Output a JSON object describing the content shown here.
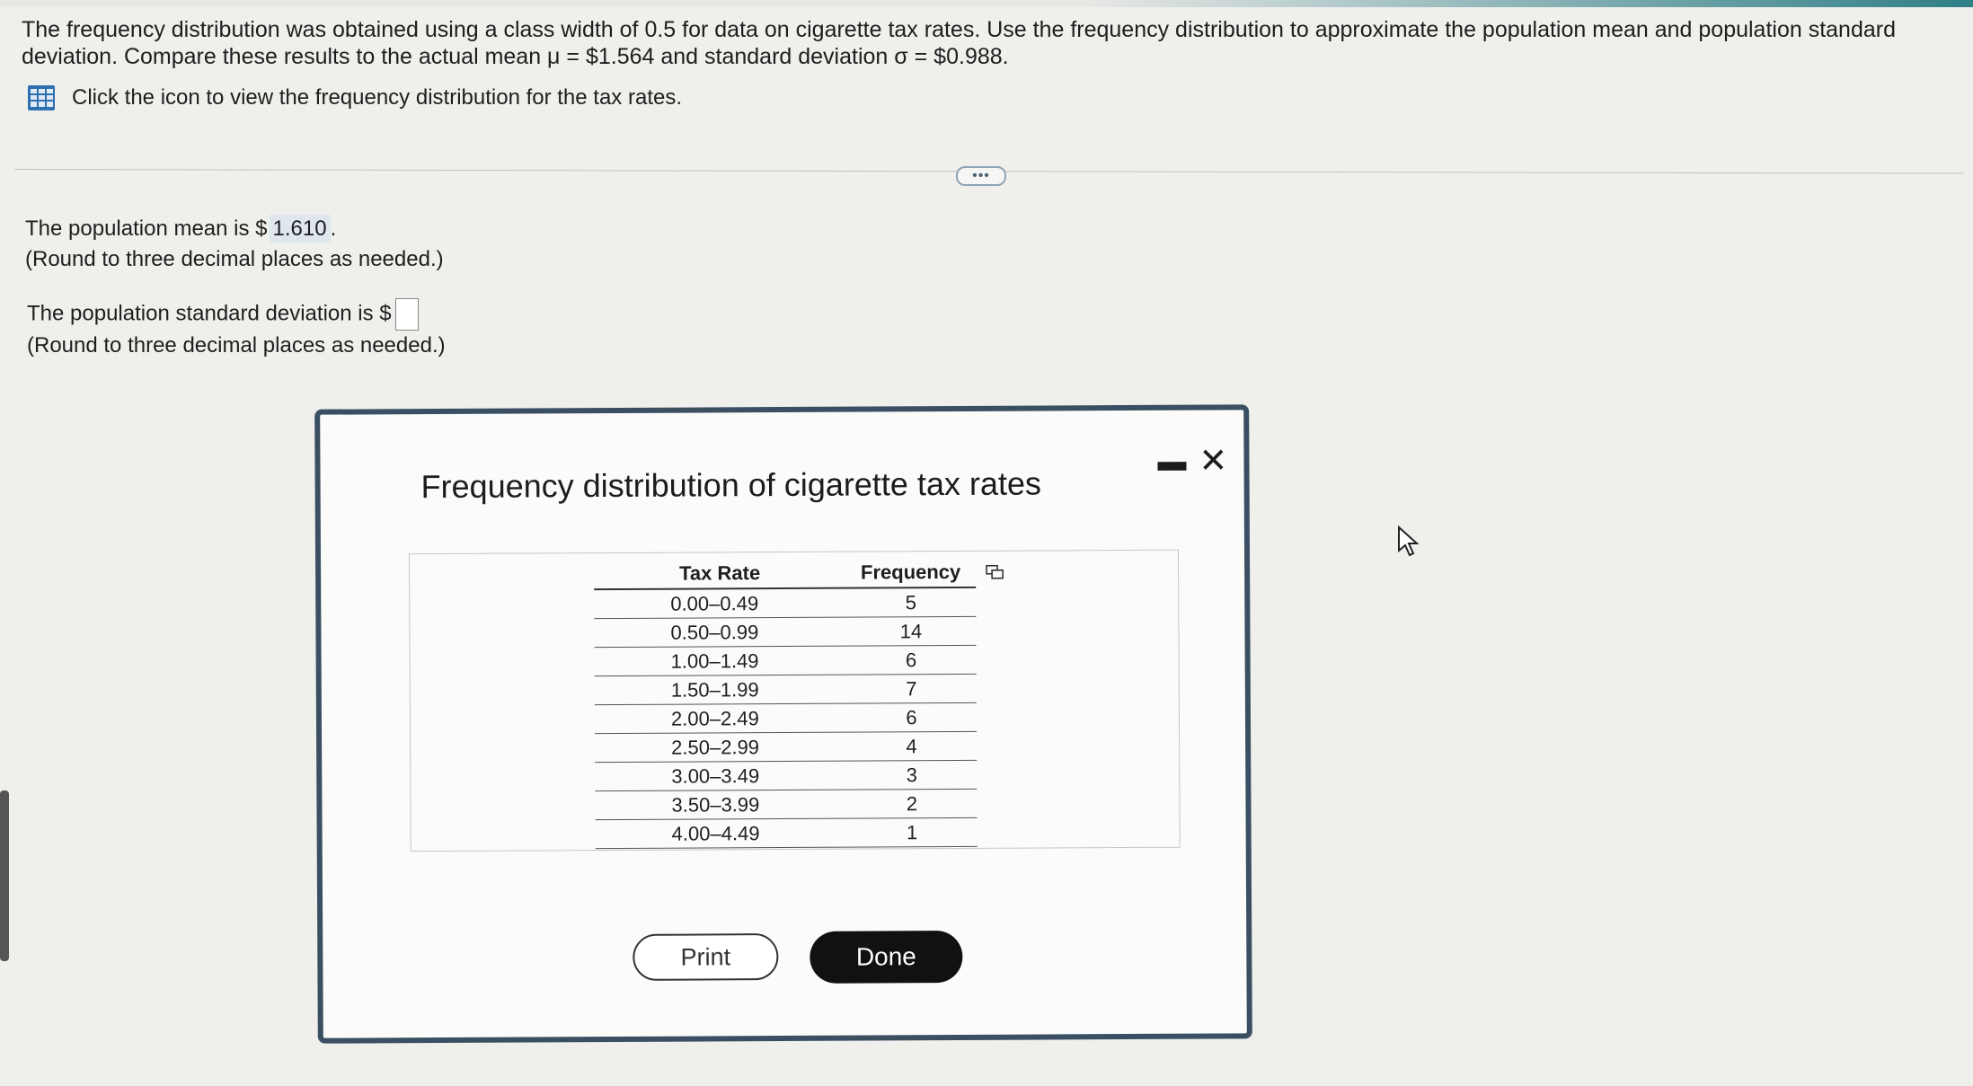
{
  "question": {
    "line1": "The frequency distribution was obtained using a class width of 0.5 for data on cigarette tax rates. Use the frequency distribution to approximate the population mean and population standard deviation. Compare these results to the actual mean μ = $1.564 and standard deviation σ = $0.988.",
    "hint": "Click the icon to view the frequency distribution for the tax rates."
  },
  "more_label": "•••",
  "answers": {
    "mean_prefix": "The population mean is $",
    "mean_value": "1.610",
    "mean_suffix": ".",
    "mean_note": "(Round to three decimal places as needed.)",
    "sd_prefix": "The population standard deviation is $",
    "sd_note": "(Round to three decimal places as needed.)"
  },
  "dialog": {
    "title": "Frequency distribution of cigarette tax rates",
    "minimize_icon": "minimize-icon",
    "close_icon": "close-icon",
    "table": {
      "headers": [
        "Tax Rate",
        "Frequency"
      ],
      "rows": [
        [
          "0.00–0.49",
          "5"
        ],
        [
          "0.50–0.99",
          "14"
        ],
        [
          "1.00–1.49",
          "6"
        ],
        [
          "1.50–1.99",
          "7"
        ],
        [
          "2.00–2.49",
          "6"
        ],
        [
          "2.50–2.99",
          "4"
        ],
        [
          "3.00–3.49",
          "3"
        ],
        [
          "3.50–3.99",
          "2"
        ],
        [
          "4.00–4.49",
          "1"
        ]
      ]
    },
    "print_label": "Print",
    "done_label": "Done"
  },
  "colors": {
    "dialog_border": "#3a4f62",
    "done_button": "#111111",
    "accent_strip": "#2f7f86"
  }
}
